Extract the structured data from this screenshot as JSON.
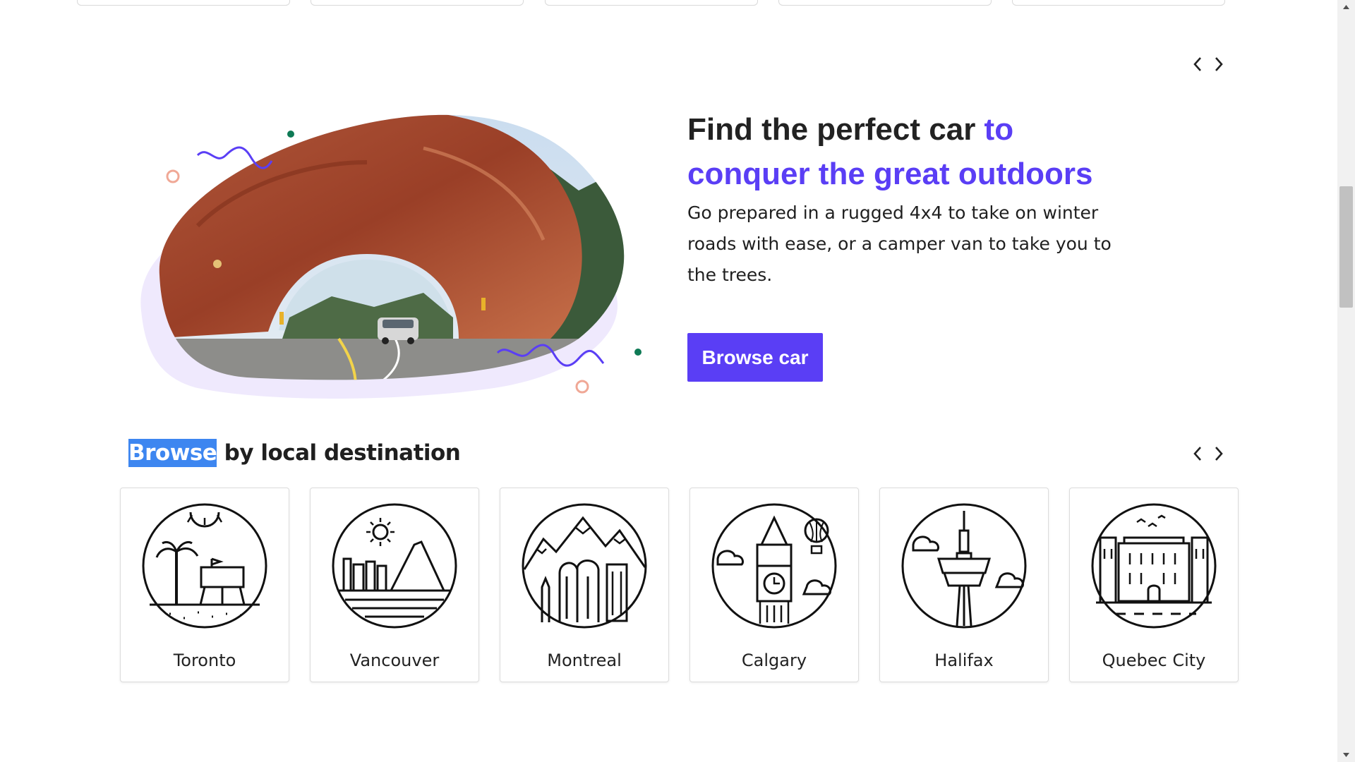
{
  "hero": {
    "title_part1": "Find the perfect car",
    "title_part2": "to conquer the great outdoors",
    "body": "Go prepared in a rugged 4x4 to take on winter roads with ease, or a camper van to take you to the trees.",
    "button_label": "Browse car",
    "accent_color": "#5a3ef5"
  },
  "destinations": {
    "title_highlight": "Browse",
    "title_rest": " by local destination",
    "cards": [
      {
        "label": "Toronto",
        "icon": "toronto-icon"
      },
      {
        "label": "Vancouver",
        "icon": "vancouver-icon"
      },
      {
        "label": "Montreal",
        "icon": "montreal-icon"
      },
      {
        "label": "Calgary",
        "icon": "calgary-icon"
      },
      {
        "label": "Halifax",
        "icon": "halifax-icon"
      },
      {
        "label": "Quebec City",
        "icon": "quebec-city-icon"
      }
    ]
  },
  "icons": {
    "prev": "chevron-left-icon",
    "next": "chevron-right-icon"
  }
}
